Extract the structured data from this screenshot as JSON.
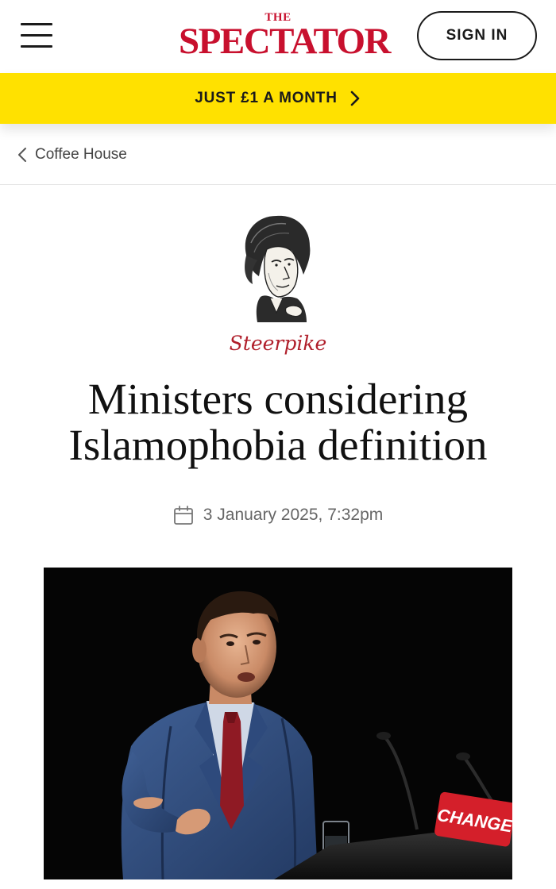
{
  "header": {
    "logo_top": "THE",
    "logo_main": "SPECTATOR",
    "signin_label": "SIGN IN",
    "brand_color": "#c8102e"
  },
  "promo": {
    "label": "JUST £1 A MONTH",
    "bg_color": "#ffe100",
    "icon": "chevron-right-icon"
  },
  "breadcrumb": {
    "label": "Coffee House",
    "icon": "chevron-left-icon"
  },
  "article": {
    "kicker": "Steerpike",
    "kicker_color": "#b01f2b",
    "headline": "Ministers considering Islamophobia definition",
    "date": "3 January 2025, 7:32pm",
    "date_icon": "calendar-icon",
    "photo": {
      "lectern_sign": "CHANGE"
    }
  }
}
